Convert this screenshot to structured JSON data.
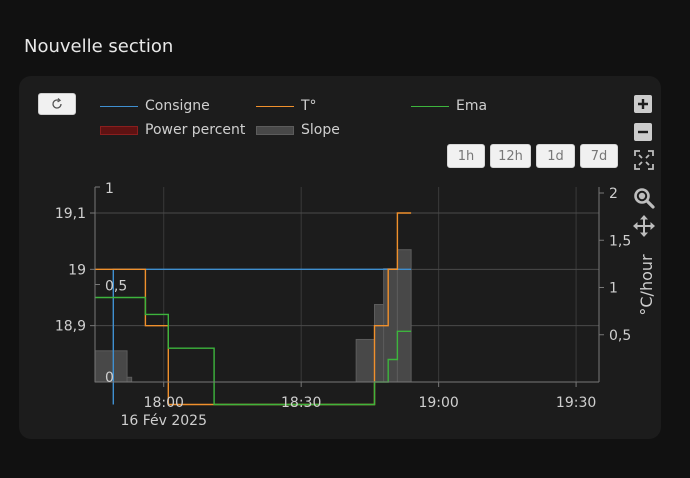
{
  "section": {
    "title": "Nouvelle section"
  },
  "toolbar": {
    "refresh_icon": "refresh-icon",
    "ranges": [
      "1h",
      "12h",
      "1d",
      "7d"
    ],
    "zoom_in_icon": "plus-icon",
    "zoom_out_icon": "minus-icon",
    "reset_icon": "fit-icon",
    "zoom_icon": "magnifier-icon",
    "pan_icon": "pan-icon"
  },
  "chart_data": {
    "type": "line",
    "x_axis": {
      "ticks": [
        "18:00",
        "18:30",
        "19:00",
        "19:30"
      ],
      "date_label": "16 Fév 2025",
      "range": [
        "17:45",
        "19:35"
      ]
    },
    "y_left": {
      "ticks": [
        "18,9",
        "19",
        "19,1"
      ],
      "range": [
        18.8,
        19.1
      ]
    },
    "y_left2": {
      "ticks": [
        "0",
        "0,5",
        "1"
      ],
      "range": [
        0,
        1
      ]
    },
    "y_right": {
      "label": "°C/hour",
      "ticks": [
        "0,5",
        "1",
        "1,5",
        "2"
      ],
      "range": [
        0,
        2
      ]
    },
    "grid": true,
    "legend": [
      {
        "name": "Consigne",
        "color": "#3f8fd0"
      },
      {
        "name": "T°",
        "color": "#f0902c"
      },
      {
        "name": "Ema",
        "color": "#3db43d"
      },
      {
        "name": "Power percent",
        "color": "#7a1414"
      },
      {
        "name": "Slope",
        "color": "#4a4a4a"
      }
    ],
    "series": [
      {
        "name": "Consigne",
        "axis": "left",
        "points": [
          [
            "17:49",
            18.76
          ],
          [
            "17:49",
            19.0
          ],
          [
            "18:54",
            19.0
          ]
        ]
      },
      {
        "name": "T°",
        "axis": "left",
        "points": [
          [
            "17:45",
            19.0
          ],
          [
            "17:56",
            19.0
          ],
          [
            "17:56",
            18.9
          ],
          [
            "18:01",
            18.9
          ],
          [
            "18:01",
            18.76
          ],
          [
            "18:46",
            18.76
          ],
          [
            "18:46",
            18.9
          ],
          [
            "18:49",
            18.9
          ],
          [
            "18:49",
            19.0
          ],
          [
            "18:51",
            19.0
          ],
          [
            "18:51",
            19.1
          ],
          [
            "18:54",
            19.1
          ]
        ]
      },
      {
        "name": "Ema",
        "axis": "left",
        "points": [
          [
            "17:45",
            18.95
          ],
          [
            "17:56",
            18.95
          ],
          [
            "17:56",
            18.92
          ],
          [
            "18:01",
            18.92
          ],
          [
            "18:01",
            18.86
          ],
          [
            "18:11",
            18.86
          ],
          [
            "18:11",
            18.76
          ],
          [
            "18:46",
            18.76
          ],
          [
            "18:46",
            18.8
          ],
          [
            "18:49",
            18.8
          ],
          [
            "18:49",
            18.84
          ],
          [
            "18:51",
            18.84
          ],
          [
            "18:51",
            18.89
          ],
          [
            "18:54",
            18.89
          ]
        ]
      },
      {
        "name": "Slope",
        "axis": "right",
        "type": "bar",
        "bars": [
          [
            "17:45",
            "17:52",
            0.33
          ],
          [
            "17:52",
            "17:53",
            0.05
          ],
          [
            "18:42",
            "18:46",
            0.45
          ],
          [
            "18:46",
            "18:48",
            0.82
          ],
          [
            "18:48",
            "18:51",
            1.2
          ],
          [
            "18:51",
            "18:54",
            1.4
          ]
        ]
      }
    ]
  }
}
